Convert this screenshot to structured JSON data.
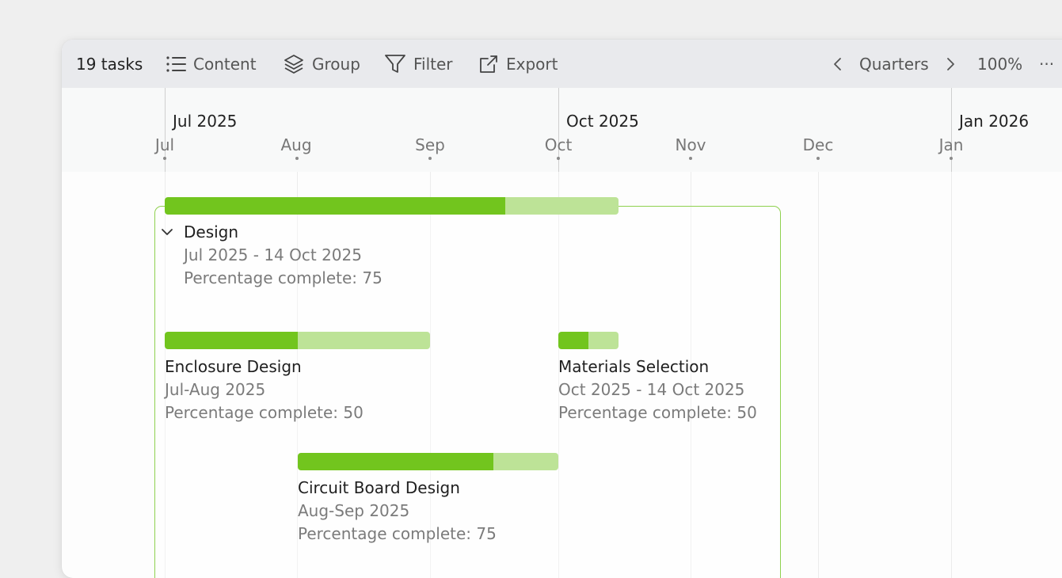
{
  "toolbar": {
    "task_count": "19 tasks",
    "content_label": "Content",
    "group_label": "Group",
    "filter_label": "Filter",
    "export_label": "Export",
    "scale_label": "Quarters",
    "zoom_label": "100%",
    "more_label": "···"
  },
  "timeline": {
    "quarters": [
      "Jul 2025",
      "Oct 2025",
      "Jan 2026"
    ],
    "months": [
      "Jul",
      "Aug",
      "Sep",
      "Oct",
      "Nov",
      "Dec",
      "Jan"
    ]
  },
  "tasks": {
    "design": {
      "title": "Design",
      "dates": "Jul 2025 - 14 Oct 2025",
      "percent_text": "Percentage complete: 75",
      "percent": 75
    },
    "enclosure": {
      "title": "Enclosure Design",
      "dates": "Jul-Aug 2025",
      "percent_text": "Percentage complete: 50",
      "percent": 50
    },
    "materials": {
      "title": "Materials Selection",
      "dates": "Oct 2025 - 14 Oct 2025",
      "percent_text": "Percentage complete: 50",
      "percent": 50
    },
    "circuit": {
      "title": "Circuit Board Design",
      "dates": "Aug-Sep 2025",
      "percent_text": "Percentage complete: 75",
      "percent": 75
    }
  },
  "colors": {
    "progress_done": "#72c51e",
    "progress_remaining": "#bde397",
    "group_border": "#8fd14f"
  }
}
